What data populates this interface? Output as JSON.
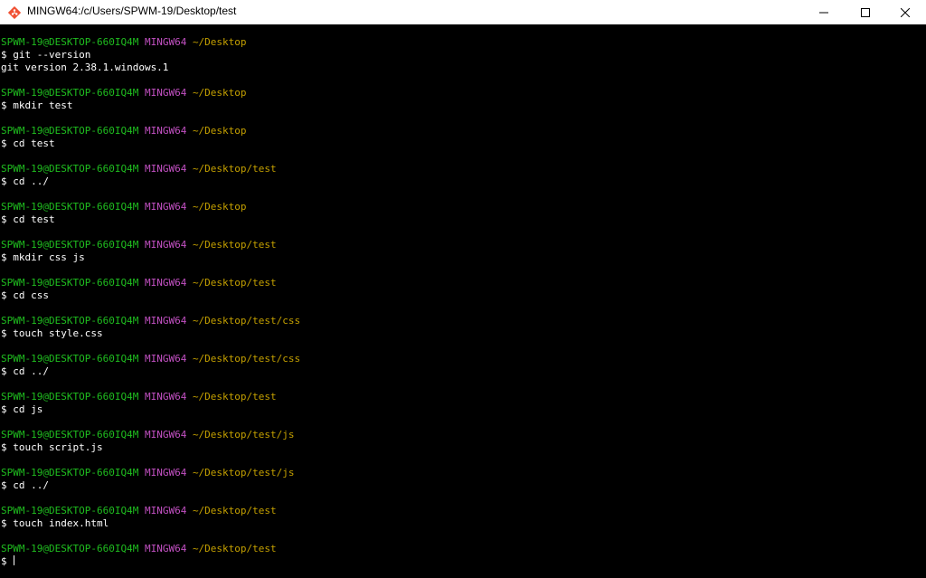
{
  "window": {
    "title": "MINGW64:/c/Users/SPWM-19/Desktop/test",
    "icon": "git-bash-icon",
    "controls": [
      "minimize-icon",
      "maximize-icon",
      "close-icon"
    ]
  },
  "colors": {
    "user": "#1fbd1f",
    "system": "#c451c4",
    "path": "#c4a000",
    "text": "#ffffff",
    "background": "#000000"
  },
  "blocks": [
    {
      "user": "SPWM-19@DESKTOP-660IQ4M",
      "sys": "MINGW64",
      "path": "~/Desktop",
      "command": "$ git --version",
      "outputs": [
        "git version 2.38.1.windows.1"
      ]
    },
    {
      "user": "SPWM-19@DESKTOP-660IQ4M",
      "sys": "MINGW64",
      "path": "~/Desktop",
      "command": "$ mkdir test",
      "outputs": []
    },
    {
      "user": "SPWM-19@DESKTOP-660IQ4M",
      "sys": "MINGW64",
      "path": "~/Desktop",
      "command": "$ cd test",
      "outputs": []
    },
    {
      "user": "SPWM-19@DESKTOP-660IQ4M",
      "sys": "MINGW64",
      "path": "~/Desktop/test",
      "command": "$ cd ../",
      "outputs": []
    },
    {
      "user": "SPWM-19@DESKTOP-660IQ4M",
      "sys": "MINGW64",
      "path": "~/Desktop",
      "command": "$ cd test",
      "outputs": []
    },
    {
      "user": "SPWM-19@DESKTOP-660IQ4M",
      "sys": "MINGW64",
      "path": "~/Desktop/test",
      "command": "$ mkdir css js",
      "outputs": []
    },
    {
      "user": "SPWM-19@DESKTOP-660IQ4M",
      "sys": "MINGW64",
      "path": "~/Desktop/test",
      "command": "$ cd css",
      "outputs": []
    },
    {
      "user": "SPWM-19@DESKTOP-660IQ4M",
      "sys": "MINGW64",
      "path": "~/Desktop/test/css",
      "command": "$ touch style.css",
      "outputs": []
    },
    {
      "user": "SPWM-19@DESKTOP-660IQ4M",
      "sys": "MINGW64",
      "path": "~/Desktop/test/css",
      "command": "$ cd ../",
      "outputs": []
    },
    {
      "user": "SPWM-19@DESKTOP-660IQ4M",
      "sys": "MINGW64",
      "path": "~/Desktop/test",
      "command": "$ cd js",
      "outputs": []
    },
    {
      "user": "SPWM-19@DESKTOP-660IQ4M",
      "sys": "MINGW64",
      "path": "~/Desktop/test/js",
      "command": "$ touch script.js",
      "outputs": []
    },
    {
      "user": "SPWM-19@DESKTOP-660IQ4M",
      "sys": "MINGW64",
      "path": "~/Desktop/test/js",
      "command": "$ cd ../",
      "outputs": []
    },
    {
      "user": "SPWM-19@DESKTOP-660IQ4M",
      "sys": "MINGW64",
      "path": "~/Desktop/test",
      "command": "$ touch index.html",
      "outputs": []
    }
  ],
  "current": {
    "user": "SPWM-19@DESKTOP-660IQ4M",
    "sys": "MINGW64",
    "path": "~/Desktop/test",
    "command": "$ "
  }
}
